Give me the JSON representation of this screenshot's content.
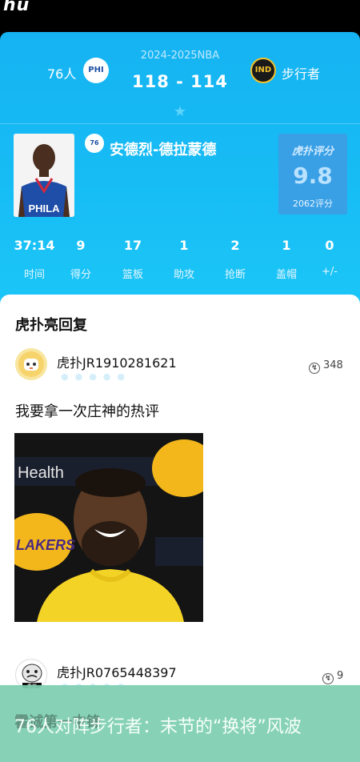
{
  "app": {
    "logo_text": "hu"
  },
  "game": {
    "season": "2024-2025NBA",
    "score": "118 - 114",
    "home_team": "76人",
    "away_team": "步行者",
    "home_logo_text": "PHI",
    "away_logo_text": "IND"
  },
  "player": {
    "name": "安德烈-德拉蒙德",
    "team_logo_text": "76",
    "jersey_text": "PHILA",
    "rating_label": "虎扑评分",
    "rating_value": "9.8",
    "rating_count": "2062评分"
  },
  "stats": [
    {
      "value": "37:14",
      "label": "时间"
    },
    {
      "value": "9",
      "label": "得分"
    },
    {
      "value": "17",
      "label": "篮板"
    },
    {
      "value": "1",
      "label": "助攻"
    },
    {
      "value": "2",
      "label": "抢断"
    },
    {
      "value": "1",
      "label": "盖帽"
    },
    {
      "value": "0",
      "label": "+/-"
    }
  ],
  "comments_section": {
    "title": "虎扑亮回复",
    "comments": [
      {
        "user": "虎扑JR1910281621",
        "likes": "348",
        "text": "我要拿一次庄神的热评",
        "image_texts": {
          "sponsor": "Health",
          "team": "LAKERS"
        }
      },
      {
        "user": "虎扑JR0765448397",
        "likes": "9",
        "avatar_text": "委屈"
      }
    ]
  },
  "toast": {
    "background_text": "霍诚第一中锋",
    "text": "76人对阵步行者：末节的“换将”风波"
  },
  "colors": {
    "header_blue": "#17bdf5",
    "rating_box": "#3aa0e6",
    "toast_green": "#7ecfb2"
  },
  "icons": {
    "star": "star-icon",
    "like": "lightbulb-icon"
  }
}
